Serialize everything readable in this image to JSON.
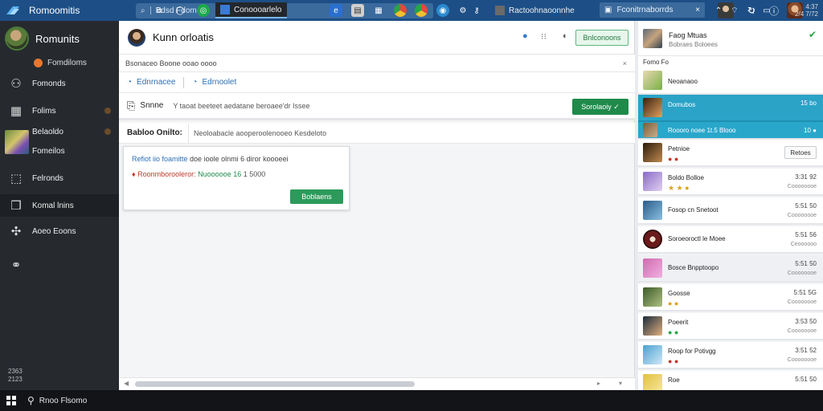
{
  "topbar": {
    "app_title": "Romoomitis",
    "search_text": "Bdsd Fdomdo",
    "field_text": "Fconitrnaborrds",
    "field_close": "×"
  },
  "sidebar": {
    "user_name": "Romunits",
    "sub_label": "Fomdiloms",
    "items": [
      {
        "label": "Fomonds",
        "icon": "stats-icon"
      },
      {
        "label": "Folims",
        "icon": "folder-icon"
      },
      {
        "label": "Belaoldo",
        "icon": "thumbnail"
      },
      {
        "label": "Fomeilos",
        "icon": "blank"
      },
      {
        "label": "Felronds",
        "icon": "box-icon"
      },
      {
        "label": "Komal lnins",
        "icon": "cube-icon"
      },
      {
        "label": "Aoeo Eoons",
        "icon": "puzzle-icon"
      },
      {
        "label": "",
        "icon": "people-icon"
      }
    ],
    "footer": [
      "2363",
      "2123"
    ]
  },
  "main": {
    "title": "Kunn orloatis",
    "header_button": "Bnlconoons",
    "notice": "Bsonaceo Boone ooao oooo",
    "notice_close": "×",
    "links": [
      "Ednrnacee",
      "Edrnoolet"
    ],
    "section_label": "Snnne",
    "section_desc": "Y taoat beeteet aedatane beroaee'dr Issee",
    "section_button": "Sorolaoiy ✓",
    "field_label": "Babloo Onilto:",
    "field_value": "Neoloabacle aooperoolenooeo Kesdeloto",
    "card": {
      "line1_link": "Refiot iio foamitte",
      "line1_text": "doe ioole olnmi 6 diror koooeei",
      "line2_red": "Roonmborooleror:",
      "line2_green": "Nuoooooe 16",
      "line2_num": "1 5000",
      "button": "Boblaens"
    }
  },
  "right": {
    "header_name": "Faog Mtuas",
    "header_sub": "Bobraes Boloees",
    "sub_label": "Fomo Fo",
    "items": [
      {
        "name": "Neoanaoo",
        "status": "",
        "time": "",
        "date": ""
      },
      {
        "name": "Domubos",
        "status": "",
        "time": "15 bo",
        "date": ""
      },
      {
        "name": "Roooro noee 1t.5 Blooo",
        "status": "",
        "time": "10 ●",
        "date": ""
      },
      {
        "name": "Petnioe",
        "status": "● ●",
        "time": "",
        "date": "",
        "button": "Retoes"
      },
      {
        "name": "Boldo Bolloe",
        "status": "★ ★ ●",
        "time": "3:31 92",
        "date": "Coooooooe"
      },
      {
        "name": "Fosop cn Snetoot",
        "status": "",
        "time": "5:51 50",
        "date": "Coooooooe"
      },
      {
        "name": "Soroeoroctl le Moee",
        "status": "",
        "time": "5:51 56",
        "date": "Ceoooooo"
      },
      {
        "name": "Bosce Bnpptoopo",
        "status": "",
        "time": "5:51 50",
        "date": "Coooooooe"
      },
      {
        "name": "Goosse",
        "status": "● ●",
        "time": "5:51 5G",
        "date": "Coooooooe"
      },
      {
        "name": "Poeerit",
        "status": "● ●",
        "time": "3:53 50",
        "date": "Coooooooe"
      },
      {
        "name": "Roop for Potivgg",
        "status": "● ●",
        "time": "3:51 52",
        "date": "Coooooooe"
      },
      {
        "name": "Roe",
        "status": "",
        "time": "5:51 50",
        "date": ""
      }
    ]
  },
  "taskbar": {
    "search_text": "Rnoo Flsomo",
    "app1": "Conoooarlelo",
    "app2": "Ractoohnaoonnhe",
    "clock_time": "4:37",
    "clock_date": "2/4 7/72"
  },
  "colors": {
    "topbar": "#1d4f86",
    "sidebar": "#262a2f",
    "accent_green": "#1f8a4a",
    "selected_blue": "#2aa3c7"
  }
}
